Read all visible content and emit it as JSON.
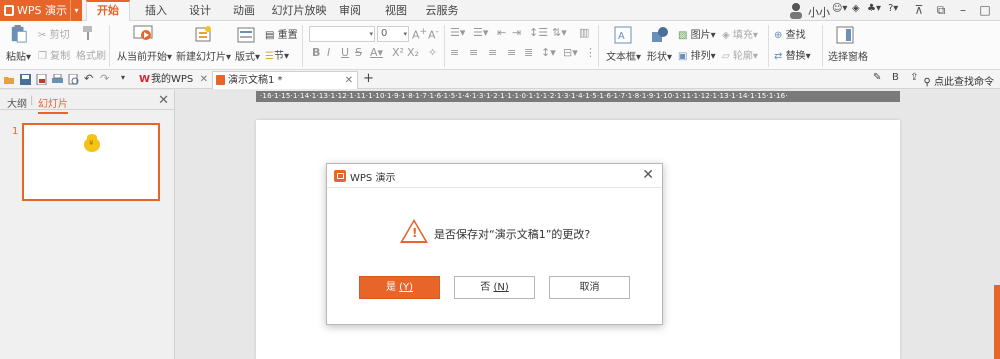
{
  "app": {
    "name": "WPS 演示",
    "accent": "#e8652a"
  },
  "menu": {
    "tabs": [
      "开始",
      "插入",
      "设计",
      "动画",
      "幻灯片放映",
      "审阅",
      "视图",
      "云服务"
    ],
    "active": "开始",
    "user": "小小"
  },
  "ribbon": {
    "paste": "粘贴",
    "cut": "剪切",
    "copy": "复制",
    "format_painter": "格式刷",
    "from_current": "从当前开始",
    "new_slide": "新建幻灯片",
    "layout": "版式",
    "reset": "重置",
    "section": "节",
    "font_size": "0",
    "text_box": "文本框",
    "shape": "形状",
    "picture": "图片",
    "fill": "填充",
    "arrange": "排列",
    "outline": "轮廓",
    "find": "查找",
    "replace": "替换",
    "select_pane": "选择窗格"
  },
  "doc_tabs": {
    "my_wps": "我的WPS",
    "current": "演示文稿1 *"
  },
  "search_cmd": "点此查找命令",
  "left_panel": {
    "tab_outline": "大纲",
    "tab_slides": "幻灯片",
    "slide_number": "1",
    "coin_symbol": "¥"
  },
  "ruler_text": "·16·1·15·1·14·1·13·1·12·1·11·1·10·1·9·1·8·1·7·1·6·1·5·1·4·1·3·1·2·1·1·1·0·1·1·1·2·1·3·1·4·1·5·1·6·1·7·1·8·1·9·1·10·1·11·1·12·1·13·1·14·1·15·1·16·",
  "dialog": {
    "title": "WPS 演示",
    "message": "是否保存对“演示文稿1”的更改?",
    "yes_label": "是",
    "yes_key": "(Y)",
    "no_label": "否",
    "no_key": "(N)",
    "cancel_label": "取消",
    "warning_symbol": "!"
  }
}
